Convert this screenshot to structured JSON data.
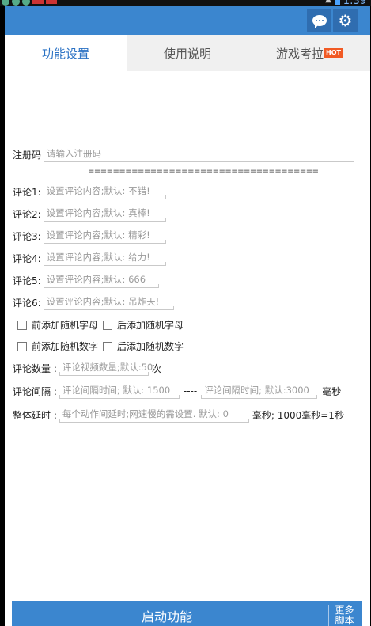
{
  "tabs": [
    "功能设置",
    "使用说明",
    "游戏考拉"
  ],
  "hot_badge": "HOT",
  "status_time": "1:39",
  "register": {
    "label": "注册码",
    "placeholder": "请输入注册码"
  },
  "separator": "=====================================",
  "comments": [
    {
      "label": "评论1:",
      "placeholder": "设置评论内容;默认: 不错!"
    },
    {
      "label": "评论2:",
      "placeholder": "设置评论内容;默认: 真棒!"
    },
    {
      "label": "评论3:",
      "placeholder": "设置评论内容;默认: 精彩!"
    },
    {
      "label": "评论4:",
      "placeholder": "设置评论内容;默认: 给力!"
    },
    {
      "label": "评论5:",
      "placeholder": "设置评论内容;默认: 666"
    },
    {
      "label": "评论6:",
      "placeholder": "设置评论内容;默认: 吊炸天!"
    }
  ],
  "checkboxes": {
    "prefix_letter": "前添加随机字母",
    "suffix_letter": "后添加随机字母",
    "prefix_number": "前添加随机数字",
    "suffix_number": "后添加随机数字"
  },
  "count": {
    "label": "评论数量 :",
    "placeholder": "评论视频数量;默认:50",
    "unit": "次"
  },
  "interval": {
    "label": "评论间隔 :",
    "min_placeholder": "评论间隔时间; 默认: 1500",
    "dash": "----",
    "max_placeholder": "评论间隔时间; 默认:3000",
    "unit": "毫秒"
  },
  "delay": {
    "label": "整体延时 :",
    "placeholder": "每个动作间延时;网速慢的需设置. 默认: 0",
    "note": "毫秒; 1000毫秒=1秒"
  },
  "start_button": "启动功能",
  "more_button": "更多\n脚本"
}
